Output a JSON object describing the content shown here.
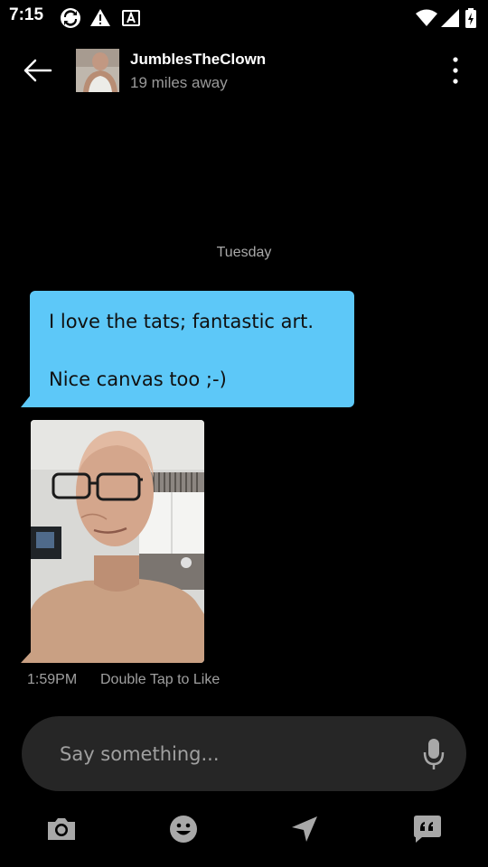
{
  "status_bar": {
    "time": "7:15",
    "icons": [
      "sync-icon",
      "warning-icon",
      "a-badge-icon",
      "wifi-icon",
      "signal-icon",
      "battery-icon"
    ]
  },
  "header": {
    "back_icon": "arrow-left-icon",
    "contact_name": "JumblesTheClown",
    "distance": "19 miles away",
    "menu_icon": "more-vertical-icon"
  },
  "conversation": {
    "day_label": "Tuesday",
    "message": {
      "lines": [
        "I love the tats; fantastic art.",
        "Nice canvas too ;-)"
      ],
      "bubble_color": "#5dc8f8"
    },
    "photo_message": {
      "time": "1:59PM",
      "action_hint": "Double Tap to Like"
    }
  },
  "composer": {
    "placeholder": "Say something...",
    "mic_icon": "microphone-icon"
  },
  "toolbar": {
    "items": [
      "camera-icon",
      "emoji-icon",
      "location-arrow-icon",
      "quick-replies-icon"
    ]
  }
}
